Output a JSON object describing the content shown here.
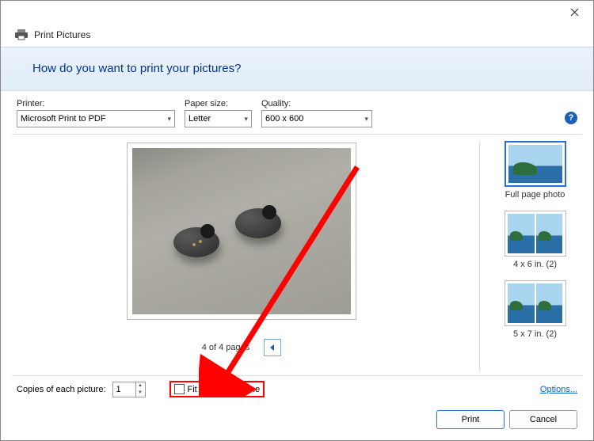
{
  "window": {
    "title": "Print Pictures",
    "banner_question": "How do you want to print your pictures?"
  },
  "config": {
    "printer_label": "Printer:",
    "printer_value": "Microsoft Print to PDF",
    "paper_label": "Paper size:",
    "paper_value": "Letter",
    "quality_label": "Quality:",
    "quality_value": "600 x 600"
  },
  "preview": {
    "page_status": "4 of 4 pages"
  },
  "layouts": {
    "items": [
      {
        "label": "Full page photo",
        "selected": true
      },
      {
        "label": "4 x 6 in. (2)",
        "selected": false
      },
      {
        "label": "5 x 7 in. (2)",
        "selected": false
      }
    ]
  },
  "footer": {
    "copies_label": "Copies of each picture:",
    "copies_value": "1",
    "fit_label": "Fit picture to frame",
    "options_link": "Options...",
    "print_btn": "Print",
    "cancel_btn": "Cancel"
  },
  "annotation": {
    "highlight_color": "#ff0000"
  }
}
